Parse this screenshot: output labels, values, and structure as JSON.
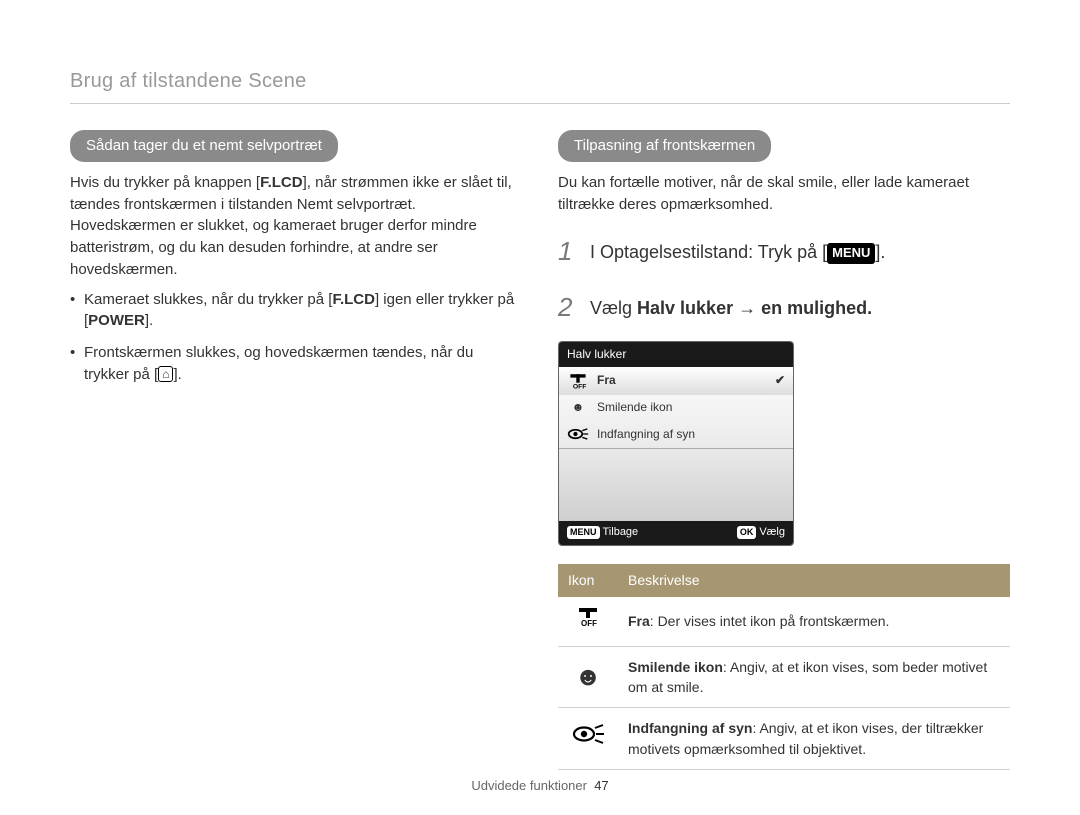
{
  "breadcrumb": "Brug af tilstandene Scene",
  "left": {
    "heading": "Sådan tager du et nemt selvportræt",
    "para1_a": "Hvis du trykker på knappen [",
    "para1_b": "], når strømmen ikke er slået til, tændes frontskærmen i tilstanden Nemt selvportræt. Hovedskærmen er slukket, og kameraet bruger derfor mindre batteristrøm, og du kan desuden forhindre, at andre ser hovedskærmen.",
    "flcd": "F.LCD",
    "bullet1_a": "Kameraet slukkes, når du trykker på [",
    "bullet1_b": "] igen eller trykker på [",
    "bullet1_c": "].",
    "power": "POWER",
    "bullet2_a": "Frontskærmen slukkes, og hovedskærmen tændes, når du trykker på [",
    "bullet2_b": "]."
  },
  "right": {
    "heading": "Tilpasning af frontskærmen",
    "intro": "Du kan fortælle motiver, når de skal smile, eller lade kameraet tiltrække deres opmærksomhed.",
    "step1": "I Optagelsestilstand: Tryk på [",
    "step1_end": "].",
    "menu_label": "MENU",
    "step2_a": "Vælg ",
    "step2_bold": "Halv lukker",
    "step2_b": " → en mulighed.",
    "screenshot": {
      "title": "Halv lukker",
      "opt1": "Fra",
      "opt2": "Smilende ikon",
      "opt3": "Indfangning af syn",
      "back_chip": "MENU",
      "back": "Tilbage",
      "ok_chip": "OK",
      "ok": "Vælg"
    },
    "table": {
      "h1": "Ikon",
      "h2": "Beskrivelse",
      "r1_bold": "Fra",
      "r1_rest": ": Der vises intet ikon på frontskærmen.",
      "r2_bold": "Smilende ikon",
      "r2_rest": ": Angiv, at et ikon vises, som beder motivet om at smile.",
      "r3_bold": "Indfangning af syn",
      "r3_rest": ": Angiv, at et ikon vises, der tiltrækker motivets opmærksomhed til objektivet."
    }
  },
  "footer_label": "Udvidede funktioner",
  "footer_page": "47"
}
